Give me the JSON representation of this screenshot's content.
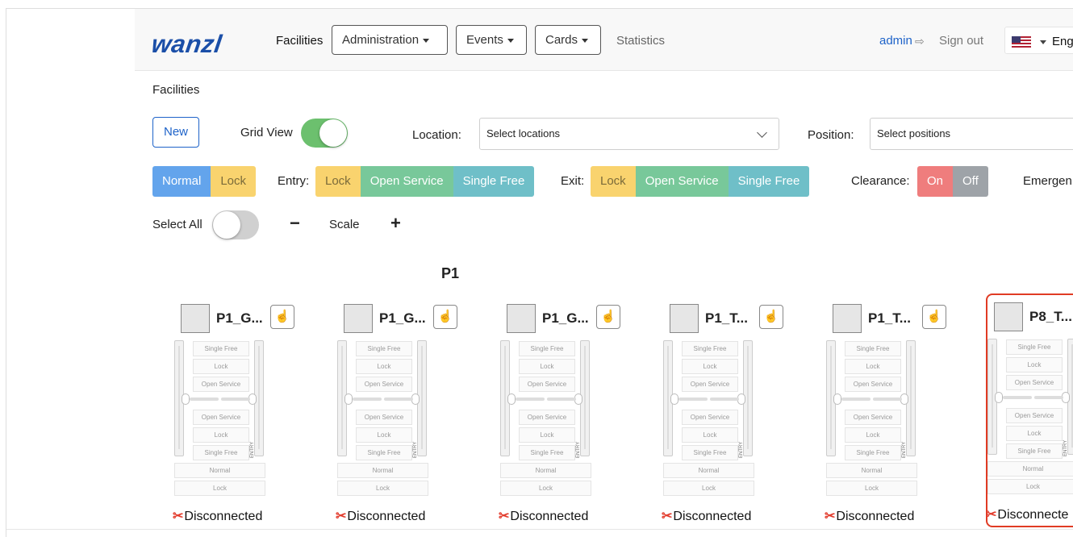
{
  "nav": {
    "logo": "wanzl",
    "facilities": "Facilities",
    "administration": "Administration",
    "events": "Events",
    "cards": "Cards",
    "statistics": "Statistics",
    "user": "admin",
    "signout": "Sign out",
    "language": "Eng"
  },
  "page": {
    "title": "Facilities",
    "new_label": "New",
    "grid_view_label": "Grid View",
    "grid_view_on": true,
    "location_label": "Location:",
    "location_placeholder": "Select locations",
    "position_label": "Position:",
    "position_placeholder": "Select positions",
    "select_all_label": "Select All",
    "select_all_on": false,
    "minus": "−",
    "scale_label": "Scale",
    "plus": "+"
  },
  "filters": {
    "mode": [
      "Normal",
      "Lock"
    ],
    "entry_label": "Entry:",
    "entry": [
      "Lock",
      "Open Service",
      "Single Free"
    ],
    "exit_label": "Exit:",
    "exit": [
      "Lock",
      "Open Service",
      "Single Free"
    ],
    "clearance_label": "Clearance:",
    "clearance": [
      "On",
      "Off"
    ],
    "emergency_label": "Emergen"
  },
  "group": {
    "title": "P1"
  },
  "card_modes": {
    "top": [
      "Single Free",
      "Lock",
      "Open Service"
    ],
    "bottom": [
      "Open Service",
      "Lock",
      "Single Free"
    ],
    "footer": [
      "Normal",
      "Lock"
    ],
    "entry": "ENTRY"
  },
  "cards": [
    {
      "name": "P1_G...",
      "status": "Disconnected",
      "selected": false
    },
    {
      "name": "P1_G...",
      "status": "Disconnected",
      "selected": false
    },
    {
      "name": "P1_G...",
      "status": "Disconnected",
      "selected": false
    },
    {
      "name": "P1_T...",
      "status": "Disconnected",
      "selected": false
    },
    {
      "name": "P1_T...",
      "status": "Disconnected",
      "selected": false
    },
    {
      "name": "P8_T...",
      "status": "Disconnecte",
      "selected": true
    }
  ],
  "colors": {
    "accent": "#1e63c9",
    "toggle_on": "#6cc06e",
    "normal": "#63a4ec",
    "lock": "#f9d36e",
    "open_service": "#78c89a",
    "single_free": "#6fbfc8",
    "clearance_on": "#ef7d7d",
    "clearance_off": "#9ea3a8",
    "selected_border": "#e03b24"
  }
}
